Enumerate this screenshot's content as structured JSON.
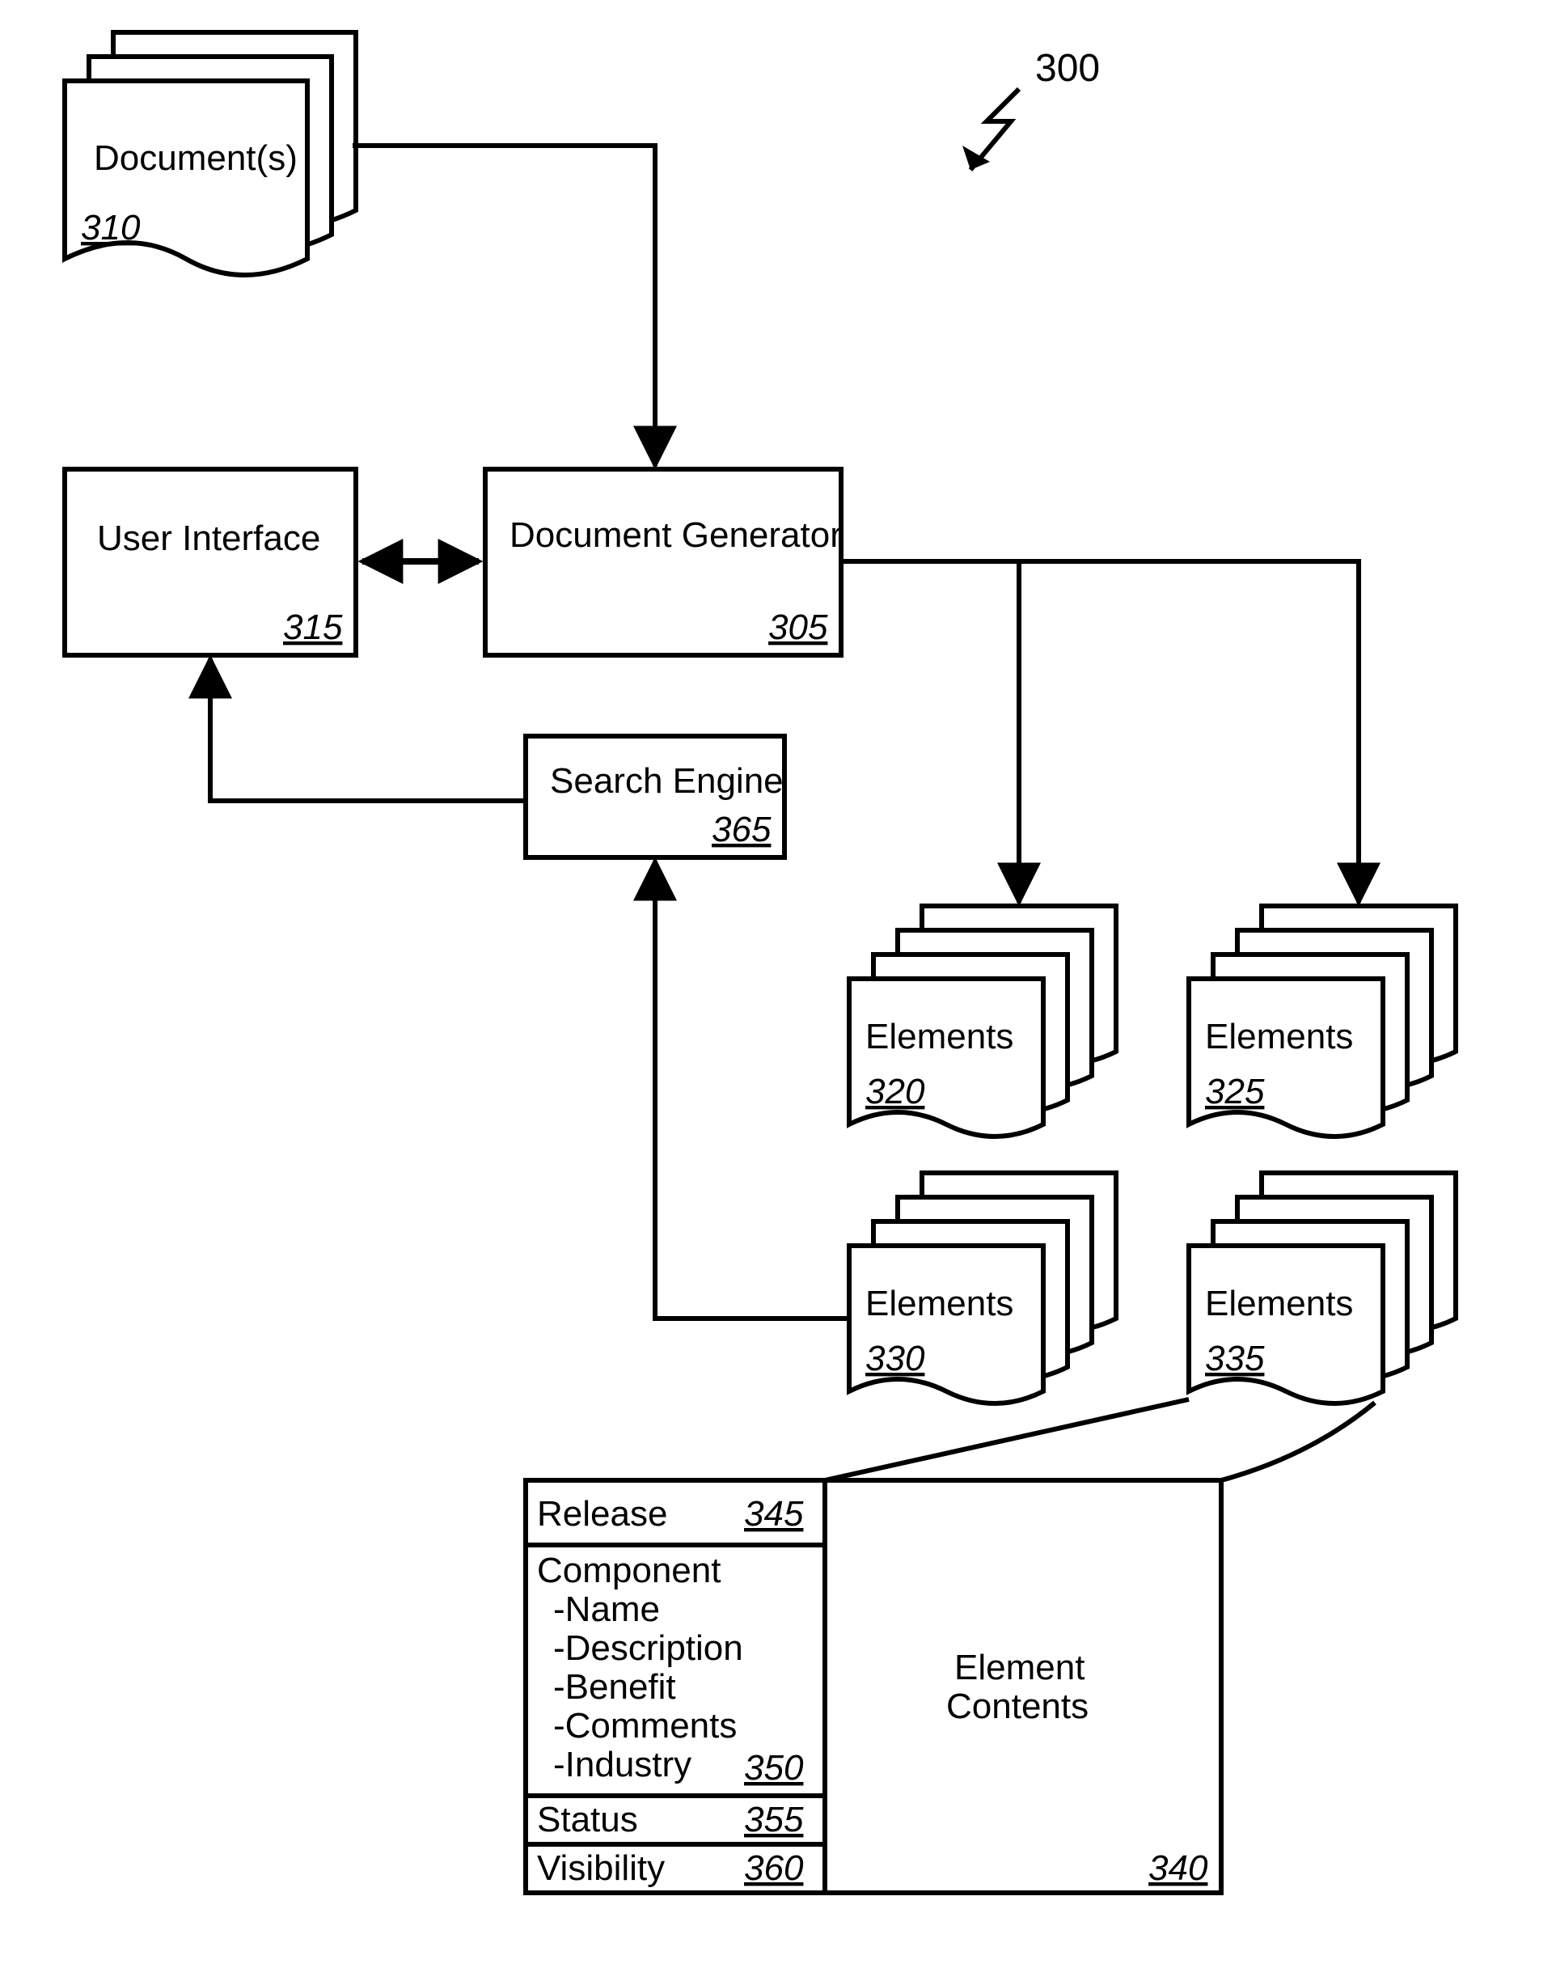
{
  "diagram_ref": "300",
  "blocks": {
    "documents": {
      "label": "Document(s)",
      "ref": "310"
    },
    "user_interface": {
      "label": "User Interface",
      "ref": "315"
    },
    "document_generator": {
      "label": "Document Generator",
      "ref": "305"
    },
    "search_engine": {
      "label": "Search Engine",
      "ref": "365"
    },
    "elements_a": {
      "label": "Elements",
      "ref": "320"
    },
    "elements_b": {
      "label": "Elements",
      "ref": "325"
    },
    "elements_c": {
      "label": "Elements",
      "ref": "330"
    },
    "elements_d": {
      "label": "Elements",
      "ref": "335"
    }
  },
  "detail_table": {
    "release": {
      "label": "Release",
      "ref": "345"
    },
    "component": {
      "label": "Component",
      "items": [
        "-Name",
        "-Description",
        "-Benefit",
        "-Comments",
        "-Industry"
      ],
      "ref": "350"
    },
    "status": {
      "label": "Status",
      "ref": "355"
    },
    "visibility": {
      "label": "Visibility",
      "ref": "360"
    },
    "element_contents": {
      "label_line1": "Element",
      "label_line2": "Contents",
      "ref": "340"
    }
  }
}
